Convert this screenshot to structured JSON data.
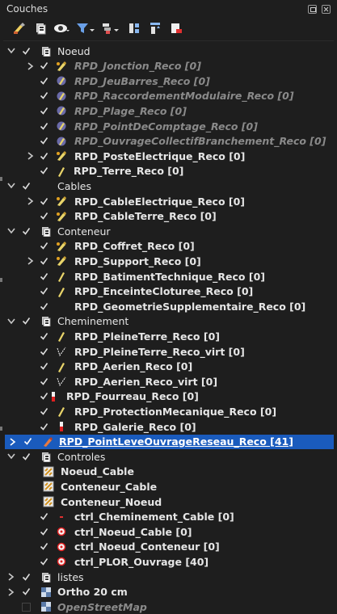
{
  "panel": {
    "title": "Couches"
  },
  "toolbar": {
    "icons": [
      "style-brush-icon",
      "add-group-icon",
      "eye-icon",
      "filter-icon",
      "legend-filter-icon",
      "expand-all-icon",
      "collapse-all-icon",
      "remove-layer-icon"
    ]
  },
  "colors": {
    "background": "#1e1e1e",
    "selected": "#1a5bbd",
    "pencil": "#e8d46a",
    "muted": "#8a8a8a"
  },
  "tree": [
    {
      "level": 0,
      "arrow": "down",
      "check": true,
      "icon": "group",
      "label": "Noeud",
      "style": "group"
    },
    {
      "level": 1,
      "arrow": "right",
      "check": true,
      "icon": "pencil",
      "label": "RPD_Jonction_Reco [0]",
      "style": "muted-italic"
    },
    {
      "level": 1,
      "arrow": "",
      "check": true,
      "icon": "nopencil",
      "label": "RPD_JeuBarres_Reco [0]",
      "style": "muted-italic"
    },
    {
      "level": 1,
      "arrow": "",
      "check": true,
      "icon": "nopencil",
      "label": "RPD_RaccordementModulaire_Reco [0]",
      "style": "muted-italic"
    },
    {
      "level": 1,
      "arrow": "",
      "check": true,
      "icon": "nopencil",
      "label": "RPD_Plage_Reco [0]",
      "style": "muted-italic"
    },
    {
      "level": 1,
      "arrow": "",
      "check": true,
      "icon": "nopencil",
      "label": "RPD_PointDeComptage_Reco [0]",
      "style": "muted-italic"
    },
    {
      "level": 1,
      "arrow": "",
      "check": true,
      "icon": "nopencil",
      "label": "RPD_OuvrageCollectifBranchement_Reco [0]",
      "style": "muted-italic"
    },
    {
      "level": 1,
      "arrow": "right",
      "check": true,
      "icon": "pencil",
      "label": "RPD_PosteElectrique_Reco [0]",
      "style": "bold"
    },
    {
      "level": 1,
      "arrow": "",
      "check": true,
      "icon": "pencil-line",
      "label": "RPD_Terre_Reco [0]",
      "style": "bold",
      "shift": -1
    },
    {
      "level": 0,
      "arrow": "down",
      "check": true,
      "icon": "",
      "label": "Cables",
      "style": "group"
    },
    {
      "level": 1,
      "arrow": "right",
      "check": true,
      "icon": "pencil",
      "label": "RPD_CableElectrique_Reco [0]",
      "style": "bold"
    },
    {
      "level": 1,
      "arrow": "",
      "check": true,
      "icon": "pencil",
      "label": "RPD_CableTerre_Reco [0]",
      "style": "bold"
    },
    {
      "level": 0,
      "arrow": "down",
      "check": true,
      "icon": "group",
      "label": "Conteneur",
      "style": "group"
    },
    {
      "level": 1,
      "arrow": "",
      "check": true,
      "icon": "pencil",
      "label": "RPD_Coffret_Reco [0]",
      "style": "bold"
    },
    {
      "level": 1,
      "arrow": "right",
      "check": true,
      "icon": "pencil",
      "label": "RPD_Support_Reco [0]",
      "style": "bold"
    },
    {
      "level": 1,
      "arrow": "",
      "check": true,
      "icon": "pencil-line",
      "label": "RPD_BatimentTechnique_Reco [0]",
      "style": "bold"
    },
    {
      "level": 1,
      "arrow": "",
      "check": true,
      "icon": "pencil-line",
      "label": "RPD_EnceinteCloturee_Reco [0]",
      "style": "bold"
    },
    {
      "level": 1,
      "arrow": "",
      "check": true,
      "icon": "",
      "label": "RPD_GeometrieSupplementaire_Reco [0]",
      "style": "bold"
    },
    {
      "level": 0,
      "arrow": "down",
      "check": true,
      "icon": "group",
      "label": "Cheminement",
      "style": "group"
    },
    {
      "level": 1,
      "arrow": "",
      "check": true,
      "icon": "pencil-line",
      "label": "RPD_PleineTerre_Reco [0]",
      "style": "bold"
    },
    {
      "level": 1,
      "arrow": "",
      "check": true,
      "icon": "dotline",
      "label": "RPD_PleineTerre_Reco_virt [0]",
      "style": "bold"
    },
    {
      "level": 1,
      "arrow": "",
      "check": true,
      "icon": "pencil-line",
      "label": "RPD_Aerien_Reco [0]",
      "style": "bold"
    },
    {
      "level": 1,
      "arrow": "",
      "check": true,
      "icon": "dotline",
      "label": "RPD_Aerien_Reco_virt [0]",
      "style": "bold"
    },
    {
      "level": 1,
      "arrow": "",
      "check": true,
      "icon": "redbar",
      "label": "RPD_Fourreau_Reco [0]",
      "style": "bold",
      "shift": -10
    },
    {
      "level": 1,
      "arrow": "",
      "check": true,
      "icon": "pencil-line",
      "label": "RPD_ProtectionMecanique_Reco [0]",
      "style": "bold"
    },
    {
      "level": 1,
      "arrow": "",
      "check": true,
      "icon": "redbar",
      "label": "RPD_Galerie_Reco [0]",
      "style": "bold"
    },
    {
      "level": 0,
      "arrow": "right",
      "check": true,
      "icon": "pencil-red",
      "label": "RPD_PointLeveOuvrageReseau_Reco [41]",
      "style": "selected"
    },
    {
      "level": 0,
      "arrow": "down",
      "check": true,
      "icon": "group",
      "label": "Controles",
      "style": "group"
    },
    {
      "level": 1,
      "arrow": "",
      "check": null,
      "icon": "table",
      "label": "Noeud_Cable",
      "style": "bold"
    },
    {
      "level": 1,
      "arrow": "",
      "check": null,
      "icon": "table",
      "label": "Conteneur_Cable",
      "style": "bold"
    },
    {
      "level": 1,
      "arrow": "",
      "check": null,
      "icon": "table",
      "label": "Conteneur_Noeud",
      "style": "bold"
    },
    {
      "level": 1,
      "arrow": "",
      "check": true,
      "icon": "reddash",
      "label": "ctrl_Cheminement_Cable [0]",
      "style": "bold"
    },
    {
      "level": 1,
      "arrow": "",
      "check": true,
      "icon": "redcircle",
      "label": "ctrl_Noeud_Cable [0]",
      "style": "bold"
    },
    {
      "level": 1,
      "arrow": "",
      "check": true,
      "icon": "redcircle",
      "label": "ctrl_Noeud_Conteneur [0]",
      "style": "bold"
    },
    {
      "level": 1,
      "arrow": "",
      "check": true,
      "icon": "redcircle",
      "label": "ctrl_PLOR_Ouvrage [40]",
      "style": "bold"
    },
    {
      "level": 0,
      "arrow": "right",
      "check": true,
      "icon": "group",
      "label": "listes",
      "style": "group"
    },
    {
      "level": 0,
      "arrow": "right",
      "check": true,
      "icon": "raster",
      "label": "Ortho 20 cm",
      "style": "bold"
    },
    {
      "level": 0,
      "arrow": "",
      "check": false,
      "icon": "raster",
      "label": "OpenStreetMap",
      "style": "muted-italic"
    }
  ]
}
